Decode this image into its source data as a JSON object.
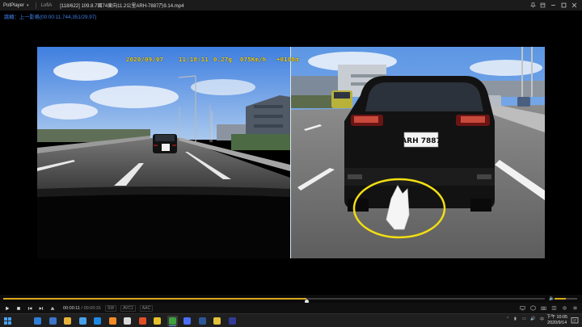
{
  "titlebar": {
    "app_name": "PotPlayer",
    "app_caret": "▾",
    "tab2": "LofiA",
    "file_title": "[118/622] 109.8.7國74東向11.2公里ARH-7887乃9.14.mp4"
  },
  "notice": "跳轉：上一影格(00:00:11.744,351/29.97)",
  "osd": {
    "date": "2020/09/07",
    "time": "11:18:11",
    "gforce": "0.27g",
    "speed": "075Km/h",
    "altitude": "+0108m"
  },
  "video": {
    "plate": "ARH 7887"
  },
  "playback": {
    "progress_fraction": 0.56,
    "volume_fraction": 0.5,
    "current_time": "00:00:11",
    "total_time": "00:00:31",
    "tag1": "SW",
    "tag2": "AVC1",
    "tag3": "AAC"
  },
  "taskbar": {
    "tray_lang": "中",
    "time": "下午 10:05",
    "date": "2020/9/14",
    "app_colors": [
      "#2f7fd8",
      "#3a76c9",
      "#e8b33a",
      "#4aa0e8",
      "#1e88e5",
      "#f28c28",
      "#d9d9d9",
      "#e34f26",
      "#e6c229",
      "#3da13d",
      "#4c6ef5",
      "#2b5797",
      "#e3c13b",
      "#333a99"
    ]
  }
}
